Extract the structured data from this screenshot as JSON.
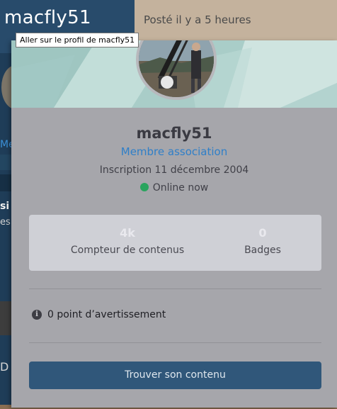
{
  "background_page": {
    "site_title": "macfly51",
    "posted_text": "Posté il y a 5 heures",
    "link_fragment": "Me",
    "heading_fragment": "si",
    "text_fragment": "es",
    "bottom_fragment": "D"
  },
  "tooltip": {
    "text": "Aller sur le profil de macfly51"
  },
  "profile_card": {
    "username": "macfly51",
    "user_title": "Membre association",
    "joined": "Inscription 11 décembre 2004",
    "online_status": "Online now",
    "stats": {
      "content_count": "4k",
      "content_label": "Compteur de contenus",
      "badges_count": "0",
      "badges_label": "Badges"
    },
    "warning_points": "0 point d’avertissement",
    "find_content_button": "Trouver son contenu"
  },
  "colors": {
    "page_background": "#1f3d58",
    "card_background": "#a6a6ab",
    "accent_link": "#2f7fc8",
    "online_indicator": "#2aa45e",
    "button": "#30577a"
  },
  "icons": {
    "online": "online-dot-icon",
    "warning": "info-circle-icon"
  }
}
